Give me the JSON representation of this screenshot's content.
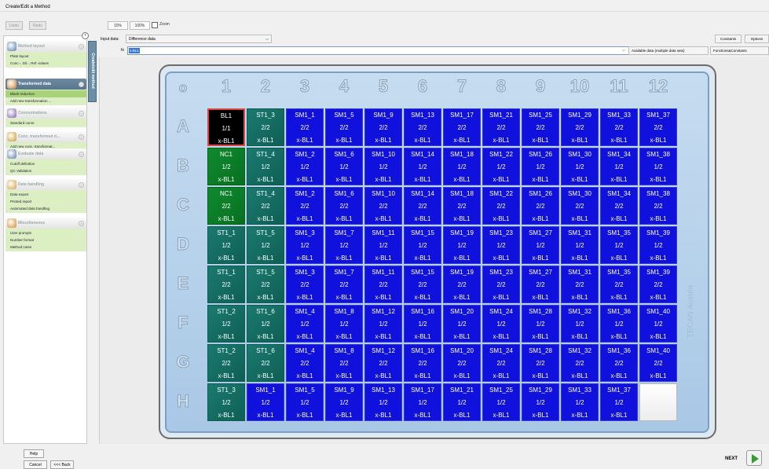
{
  "window": {
    "title": "Create/Edit a Method"
  },
  "toolbar": {
    "undo": "Undo",
    "redo": "Redo",
    "zoom10": "10%",
    "zoom100": "100%",
    "zoom_label": "Zoom"
  },
  "sidebar": {
    "tab_label": "Create/edit method",
    "sections": [
      {
        "title": "Method layout",
        "active": false,
        "icon": "method-layout-icon",
        "items": [
          "Plate layout",
          "Conc.-, Dil.-, Ref.-values"
        ],
        "selected": -1
      },
      {
        "title": "Transformed data",
        "active": true,
        "icon": "transformed-data-icon",
        "items": [
          "Blank reduction",
          "Add new transformation ..."
        ],
        "selected": 0
      },
      {
        "title": "Concentrations",
        "active": false,
        "icon": "concentrations-icon",
        "items": [
          "Standard curve"
        ],
        "selected": -1
      },
      {
        "title": "Conc. transformed d...",
        "active": false,
        "icon": "conc-transformed-icon",
        "items": [
          "Add new conc. transformat..."
        ],
        "selected": -1
      },
      {
        "title": "Evaluate data",
        "active": false,
        "icon": "evaluate-data-icon",
        "items": [
          "Cutoff definition",
          "QC Validation"
        ],
        "selected": -1
      },
      {
        "title": "Data handling",
        "active": false,
        "icon": "data-handling-icon",
        "items": [
          "Data export",
          "Printed report",
          "Automated data handling"
        ],
        "selected": -1
      },
      {
        "title": "Miscellaneous",
        "active": false,
        "icon": "miscellaneous-icon",
        "items": [
          "User prompts",
          "Number format",
          "Method notes"
        ],
        "selected": -1
      }
    ]
  },
  "input": {
    "label": "Input data:",
    "value": "Difference data"
  },
  "formula": {
    "label": "fx",
    "value": "x-BL1"
  },
  "buttons": {
    "constants": "Constants",
    "options": "Options",
    "available": "Available data (multiple data sets)",
    "functions": "Functions&Constants"
  },
  "plate": {
    "corner": "o",
    "columns": [
      "1",
      "2",
      "3",
      "4",
      "5",
      "6",
      "7",
      "8",
      "9",
      "10",
      "11",
      "12"
    ],
    "rows": [
      "A",
      "B",
      "C",
      "D",
      "E",
      "F",
      "G",
      "H"
    ],
    "watermark": "TECAN Austria",
    "wells": [
      [
        [
          "BL1",
          "1/1",
          "x-BL1",
          "bl"
        ],
        [
          "ST1_3",
          "2/2",
          "x-BL1",
          "st"
        ],
        [
          "SM1_1",
          "2/2",
          "x-BL1",
          "s"
        ],
        [
          "SM1_5",
          "2/2",
          "x-BL1",
          "s"
        ],
        [
          "SM1_9",
          "2/2",
          "x-BL1",
          "s"
        ],
        [
          "SM1_13",
          "2/2",
          "x-BL1",
          "s"
        ],
        [
          "SM1_17",
          "2/2",
          "x-BL1",
          "s"
        ],
        [
          "SM1_21",
          "2/2",
          "x-BL1",
          "s"
        ],
        [
          "SM1_25",
          "2/2",
          "x-BL1",
          "s"
        ],
        [
          "SM1_29",
          "2/2",
          "x-BL1",
          "s"
        ],
        [
          "SM1_33",
          "2/2",
          "x-BL1",
          "s"
        ],
        [
          "SM1_37",
          "2/2",
          "x-BL1",
          "s"
        ]
      ],
      [
        [
          "NC1",
          "1/2",
          "x-BL1",
          "nc"
        ],
        [
          "ST1_4",
          "1/2",
          "x-BL1",
          "st"
        ],
        [
          "SM1_2",
          "1/2",
          "x-BL1",
          "s"
        ],
        [
          "SM1_6",
          "1/2",
          "x-BL1",
          "s"
        ],
        [
          "SM1_10",
          "1/2",
          "x-BL1",
          "s"
        ],
        [
          "SM1_14",
          "1/2",
          "x-BL1",
          "s"
        ],
        [
          "SM1_18",
          "1/2",
          "x-BL1",
          "s"
        ],
        [
          "SM1_22",
          "1/2",
          "x-BL1",
          "s"
        ],
        [
          "SM1_26",
          "1/2",
          "x-BL1",
          "s"
        ],
        [
          "SM1_30",
          "1/2",
          "x-BL1",
          "s"
        ],
        [
          "SM1_34",
          "1/2",
          "x-BL1",
          "s"
        ],
        [
          "SM1_38",
          "1/2",
          "x-BL1",
          "s"
        ]
      ],
      [
        [
          "NC1",
          "2/2",
          "x-BL1",
          "nc"
        ],
        [
          "ST1_4",
          "2/2",
          "x-BL1",
          "st"
        ],
        [
          "SM1_2",
          "2/2",
          "x-BL1",
          "s"
        ],
        [
          "SM1_6",
          "2/2",
          "x-BL1",
          "s"
        ],
        [
          "SM1_10",
          "2/2",
          "x-BL1",
          "s"
        ],
        [
          "SM1_14",
          "2/2",
          "x-BL1",
          "s"
        ],
        [
          "SM1_18",
          "2/2",
          "x-BL1",
          "s"
        ],
        [
          "SM1_22",
          "2/2",
          "x-BL1",
          "s"
        ],
        [
          "SM1_26",
          "2/2",
          "x-BL1",
          "s"
        ],
        [
          "SM1_30",
          "2/2",
          "x-BL1",
          "s"
        ],
        [
          "SM1_34",
          "2/2",
          "x-BL1",
          "s"
        ],
        [
          "SM1_38",
          "2/2",
          "x-BL1",
          "s"
        ]
      ],
      [
        [
          "ST1_1",
          "1/2",
          "x-BL1",
          "st"
        ],
        [
          "ST1_5",
          "1/2",
          "x-BL1",
          "st"
        ],
        [
          "SM1_3",
          "1/2",
          "x-BL1",
          "s"
        ],
        [
          "SM1_7",
          "1/2",
          "x-BL1",
          "s"
        ],
        [
          "SM1_11",
          "1/2",
          "x-BL1",
          "s"
        ],
        [
          "SM1_15",
          "1/2",
          "x-BL1",
          "s"
        ],
        [
          "SM1_19",
          "1/2",
          "x-BL1",
          "s"
        ],
        [
          "SM1_23",
          "1/2",
          "x-BL1",
          "s"
        ],
        [
          "SM1_27",
          "1/2",
          "x-BL1",
          "s"
        ],
        [
          "SM1_31",
          "1/2",
          "x-BL1",
          "s"
        ],
        [
          "SM1_35",
          "1/2",
          "x-BL1",
          "s"
        ],
        [
          "SM1_39",
          "1/2",
          "x-BL1",
          "s"
        ]
      ],
      [
        [
          "ST1_1",
          "2/2",
          "x-BL1",
          "st"
        ],
        [
          "ST1_5",
          "2/2",
          "x-BL1",
          "st"
        ],
        [
          "SM1_3",
          "2/2",
          "x-BL1",
          "s"
        ],
        [
          "SM1_7",
          "2/2",
          "x-BL1",
          "s"
        ],
        [
          "SM1_11",
          "2/2",
          "x-BL1",
          "s"
        ],
        [
          "SM1_15",
          "2/2",
          "x-BL1",
          "s"
        ],
        [
          "SM1_19",
          "2/2",
          "x-BL1",
          "s"
        ],
        [
          "SM1_23",
          "2/2",
          "x-BL1",
          "s"
        ],
        [
          "SM1_27",
          "2/2",
          "x-BL1",
          "s"
        ],
        [
          "SM1_31",
          "2/2",
          "x-BL1",
          "s"
        ],
        [
          "SM1_35",
          "2/2",
          "x-BL1",
          "s"
        ],
        [
          "SM1_39",
          "2/2",
          "x-BL1",
          "s"
        ]
      ],
      [
        [
          "ST1_2",
          "1/2",
          "x-BL1",
          "st"
        ],
        [
          "ST1_6",
          "1/2",
          "x-BL1",
          "st"
        ],
        [
          "SM1_4",
          "1/2",
          "x-BL1",
          "s"
        ],
        [
          "SM1_8",
          "1/2",
          "x-BL1",
          "s"
        ],
        [
          "SM1_12",
          "1/2",
          "x-BL1",
          "s"
        ],
        [
          "SM1_16",
          "1/2",
          "x-BL1",
          "s"
        ],
        [
          "SM1_20",
          "1/2",
          "x-BL1",
          "s"
        ],
        [
          "SM1_24",
          "1/2",
          "x-BL1",
          "s"
        ],
        [
          "SM1_28",
          "1/2",
          "x-BL1",
          "s"
        ],
        [
          "SM1_32",
          "1/2",
          "x-BL1",
          "s"
        ],
        [
          "SM1_36",
          "1/2",
          "x-BL1",
          "s"
        ],
        [
          "SM1_40",
          "1/2",
          "x-BL1",
          "s"
        ]
      ],
      [
        [
          "ST1_2",
          "2/2",
          "x-BL1",
          "st"
        ],
        [
          "ST1_6",
          "2/2",
          "x-BL1",
          "st"
        ],
        [
          "SM1_4",
          "2/2",
          "x-BL1",
          "s"
        ],
        [
          "SM1_8",
          "2/2",
          "x-BL1",
          "s"
        ],
        [
          "SM1_12",
          "2/2",
          "x-BL1",
          "s"
        ],
        [
          "SM1_16",
          "2/2",
          "x-BL1",
          "s"
        ],
        [
          "SM1_20",
          "2/2",
          "x-BL1",
          "s"
        ],
        [
          "SM1_24",
          "2/2",
          "x-BL1",
          "s"
        ],
        [
          "SM1_28",
          "2/2",
          "x-BL1",
          "s"
        ],
        [
          "SM1_32",
          "2/2",
          "x-BL1",
          "s"
        ],
        [
          "SM1_36",
          "2/2",
          "x-BL1",
          "s"
        ],
        [
          "SM1_40",
          "2/2",
          "x-BL1",
          "s"
        ]
      ],
      [
        [
          "ST1_3",
          "1/2",
          "x-BL1",
          "st"
        ],
        [
          "SM1_1",
          "1/2",
          "x-BL1",
          "s"
        ],
        [
          "SM1_5",
          "1/2",
          "x-BL1",
          "s"
        ],
        [
          "SM1_9",
          "1/2",
          "x-BL1",
          "s"
        ],
        [
          "SM1_13",
          "1/2",
          "x-BL1",
          "s"
        ],
        [
          "SM1_17",
          "1/2",
          "x-BL1",
          "s"
        ],
        [
          "SM1_21",
          "1/2",
          "x-BL1",
          "s"
        ],
        [
          "SM1_25",
          "1/2",
          "x-BL1",
          "s"
        ],
        [
          "SM1_29",
          "1/2",
          "x-BL1",
          "s"
        ],
        [
          "SM1_33",
          "1/2",
          "x-BL1",
          "s"
        ],
        [
          "SM1_37",
          "1/2",
          "x-BL1",
          "s"
        ],
        [
          "",
          "",
          "",
          "empty"
        ]
      ]
    ]
  },
  "footer": {
    "help": "Help",
    "cancel": "Cancel",
    "back": "<<< Back",
    "next": "NEXT"
  },
  "colors": {
    "sample": "#1111dd",
    "standard": "#1a7a6f",
    "negative_control": "#0f8a30",
    "blank": "#000000",
    "sidebar_items": "#dcefc2",
    "sidebar_selected": "#a8d37a"
  }
}
